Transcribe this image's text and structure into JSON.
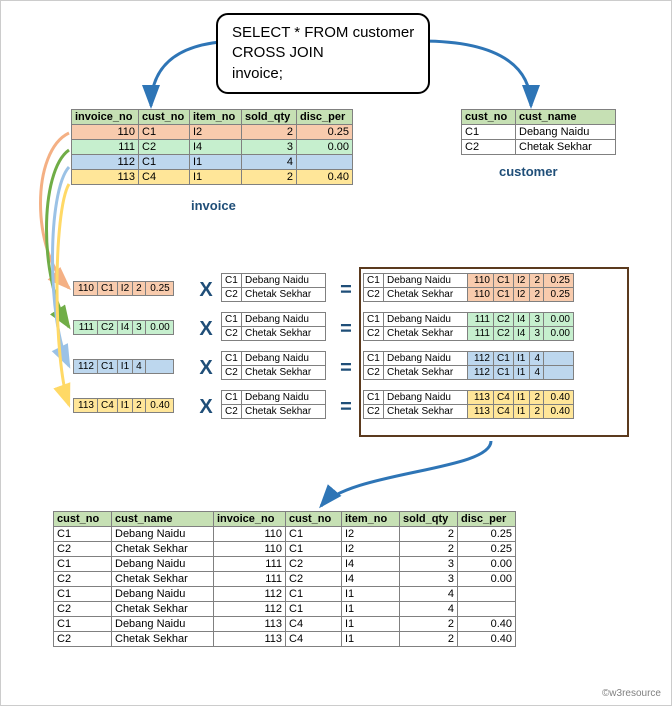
{
  "sql": {
    "line1": "SELECT * FROM customer",
    "line2": "CROSS JOIN",
    "line3": "invoice;"
  },
  "captions": {
    "invoice": "invoice",
    "customer": "customer"
  },
  "attribution": "©w3resource",
  "invoice": {
    "headers": [
      "invoice_no",
      "cust_no",
      "item_no",
      "sold_qty",
      "disc_per"
    ],
    "rows": [
      {
        "cells": [
          "110",
          "C1",
          "I2",
          "2",
          "0.25"
        ],
        "color": "red"
      },
      {
        "cells": [
          "111",
          "C2",
          "I4",
          "3",
          "0.00"
        ],
        "color": "green"
      },
      {
        "cells": [
          "112",
          "C1",
          "I1",
          "4",
          ""
        ],
        "color": "blue"
      },
      {
        "cells": [
          "113",
          "C4",
          "I1",
          "2",
          "0.40"
        ],
        "color": "yellow"
      }
    ]
  },
  "customer": {
    "headers": [
      "cust_no",
      "cust_name"
    ],
    "rows": [
      {
        "cells": [
          "C1",
          "Debang Naidu"
        ]
      },
      {
        "cells": [
          "C2",
          "Chetak Sekhar"
        ]
      }
    ]
  },
  "cross_rows": [
    {
      "inv": [
        "110",
        "C1",
        "I2",
        "2",
        "0.25"
      ],
      "color": "red"
    },
    {
      "inv": [
        "111",
        "C2",
        "I4",
        "3",
        "0.00"
      ],
      "color": "green"
    },
    {
      "inv": [
        "112",
        "C1",
        "I1",
        "4",
        ""
      ],
      "color": "blue"
    },
    {
      "inv": [
        "113",
        "C4",
        "I1",
        "2",
        "0.40"
      ],
      "color": "yellow"
    }
  ],
  "cust_pair": [
    {
      "cells": [
        "C1",
        "Debang Naidu"
      ]
    },
    {
      "cells": [
        "C2",
        "Chetak Sekhar"
      ]
    }
  ],
  "result_rows": [
    [
      {
        "cells": [
          "C1",
          "Debang Naidu",
          "110",
          "C1",
          "I2",
          "2",
          "0.25"
        ],
        "color": "red"
      },
      {
        "cells": [
          "C2",
          "Chetak Sekhar",
          "110",
          "C1",
          "I2",
          "2",
          "0.25"
        ],
        "color": "red"
      }
    ],
    [
      {
        "cells": [
          "C1",
          "Debang Naidu",
          "111",
          "C2",
          "I4",
          "3",
          "0.00"
        ],
        "color": "green"
      },
      {
        "cells": [
          "C2",
          "Chetak Sekhar",
          "111",
          "C2",
          "I4",
          "3",
          "0.00"
        ],
        "color": "green"
      }
    ],
    [
      {
        "cells": [
          "C1",
          "Debang Naidu",
          "112",
          "C1",
          "I1",
          "4",
          ""
        ],
        "color": "blue"
      },
      {
        "cells": [
          "C2",
          "Chetak Sekhar",
          "112",
          "C1",
          "I1",
          "4",
          ""
        ],
        "color": "blue"
      }
    ],
    [
      {
        "cells": [
          "C1",
          "Debang Naidu",
          "113",
          "C4",
          "I1",
          "2",
          "0.40"
        ],
        "color": "yellow"
      },
      {
        "cells": [
          "C2",
          "Chetak Sekhar",
          "113",
          "C4",
          "I1",
          "2",
          "0.40"
        ],
        "color": "yellow"
      }
    ]
  ],
  "final": {
    "headers": [
      "cust_no",
      "cust_name",
      "invoice_no",
      "cust_no",
      "item_no",
      "sold_qty",
      "disc_per"
    ],
    "rows": [
      [
        "C1",
        "Debang Naidu",
        "110",
        "C1",
        "I2",
        "2",
        "0.25"
      ],
      [
        "C2",
        "Chetak Sekhar",
        "110",
        "C1",
        "I2",
        "2",
        "0.25"
      ],
      [
        "C1",
        "Debang Naidu",
        "111",
        "C2",
        "I4",
        "3",
        "0.00"
      ],
      [
        "C2",
        "Chetak Sekhar",
        "111",
        "C2",
        "I4",
        "3",
        "0.00"
      ],
      [
        "C1",
        "Debang Naidu",
        "112",
        "C1",
        "I1",
        "4",
        ""
      ],
      [
        "C2",
        "Chetak Sekhar",
        "112",
        "C1",
        "I1",
        "4",
        ""
      ],
      [
        "C1",
        "Debang Naidu",
        "113",
        "C4",
        "I1",
        "2",
        "0.40"
      ],
      [
        "C2",
        "Chetak Sekhar",
        "113",
        "C4",
        "I1",
        "2",
        "0.40"
      ]
    ]
  },
  "ops": {
    "x": "X",
    "eq": "="
  }
}
